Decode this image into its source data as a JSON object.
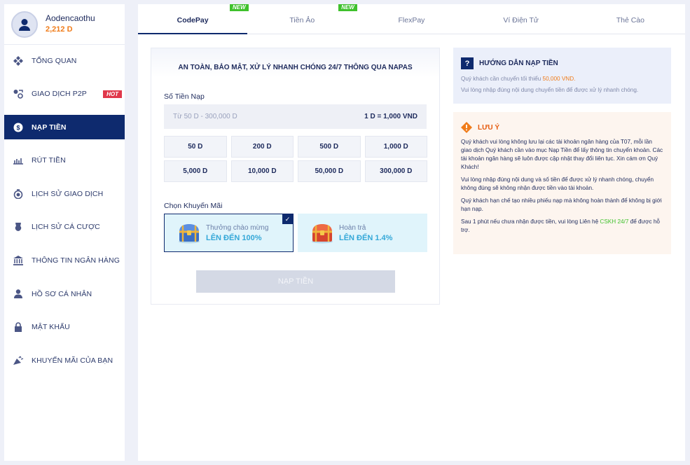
{
  "profile": {
    "username": "Aodencaothu",
    "balance": "2,212 D"
  },
  "sidebar": {
    "items": [
      {
        "label": "TỔNG QUAN",
        "icon": "overview-icon"
      },
      {
        "label": "GIAO DỊCH P2P",
        "icon": "p2p-icon",
        "badge": "HOT"
      },
      {
        "label": "NẠP TIỀN",
        "icon": "deposit-icon",
        "active": true
      },
      {
        "label": "RÚT TIỀN",
        "icon": "withdraw-icon"
      },
      {
        "label": "LỊCH SỬ GIAO DỊCH",
        "icon": "transaction-history-icon"
      },
      {
        "label": "LỊCH SỬ CÁ CƯỢC",
        "icon": "bet-history-icon"
      },
      {
        "label": "THÔNG TIN NGÂN HÀNG",
        "icon": "bank-icon"
      },
      {
        "label": "HỒ SƠ CÁ NHÂN",
        "icon": "user-icon"
      },
      {
        "label": "MẬT KHẨU",
        "icon": "lock-icon"
      },
      {
        "label": "KHUYẾN MÃI CỦA BẠN",
        "icon": "promotion-icon"
      }
    ]
  },
  "tabs": [
    {
      "label": "CodePay",
      "active": true,
      "badge": "NEW"
    },
    {
      "label": "Tiền Ảo",
      "badge": "NEW"
    },
    {
      "label": "FlexPay"
    },
    {
      "label": "Ví Điện Tử"
    },
    {
      "label": "Thẻ Cào"
    }
  ],
  "deposit": {
    "title": "AN TOÀN, BẢO MẬT, XỬ LÝ NHANH CHÓNG 24/7 THÔNG QUA NAPAS",
    "amount_label": "Số Tiền Nạp",
    "amount_placeholder": "Từ 50 D - 300,000 D",
    "rate": "1 D = 1,000 VND",
    "amounts": [
      "50 D",
      "200 D",
      "500 D",
      "1,000 D",
      "5,000 D",
      "10,000 D",
      "50,000 D",
      "300,000 D"
    ],
    "promo_label": "Chọn Khuyến Mãi",
    "promos": [
      {
        "title": "Thưởng chào mừng",
        "value": "LÊN ĐẾN 100%",
        "selected": true
      },
      {
        "title": "Hoàn trả",
        "value": "LÊN ĐẾN 1.4%"
      }
    ],
    "submit_label": "NẠP TIỀN"
  },
  "guide": {
    "title": "HƯỚNG DẪN NẠP TIỀN",
    "line1_prefix": "Quý khách cần chuyển tối thiểu ",
    "line1_amount": "50,000 VND.",
    "line2": "Vui lòng nhập đúng nội dung chuyển tiền để được xử lý nhanh chóng."
  },
  "note": {
    "title": "LƯU Ý",
    "p1": "Quý khách vui lòng không lưu lại các tài khoản ngân hàng của T07, mỗi lần giao dịch Quý khách cần vào mục Nạp Tiền để lấy thông tin chuyển khoản. Các tài khoản ngân hàng sẽ luôn được cập nhật thay đổi liên tục. Xin cám ơn Quý Khách!",
    "p2": "Vui lòng nhập đúng nội dung và số tiền để được xử lý nhanh chóng, chuyển không đúng sẽ không nhận được tiền vào tài khoản.",
    "p3": "Quý khách hạn chế tạo nhiều phiếu nạp mà không hoàn thành để không bị giới hạn nạp.",
    "p4_prefix": "Sau 1 phút nếu chưa nhận được tiền, vui lòng Liên hệ ",
    "p4_link": "CSKH 24/7",
    "p4_suffix": " để được hỗ trợ."
  },
  "colors": {
    "primary": "#0e2a6e",
    "accent": "#f07c1a",
    "hot": "#e0384b",
    "new": "#3fc12c"
  }
}
